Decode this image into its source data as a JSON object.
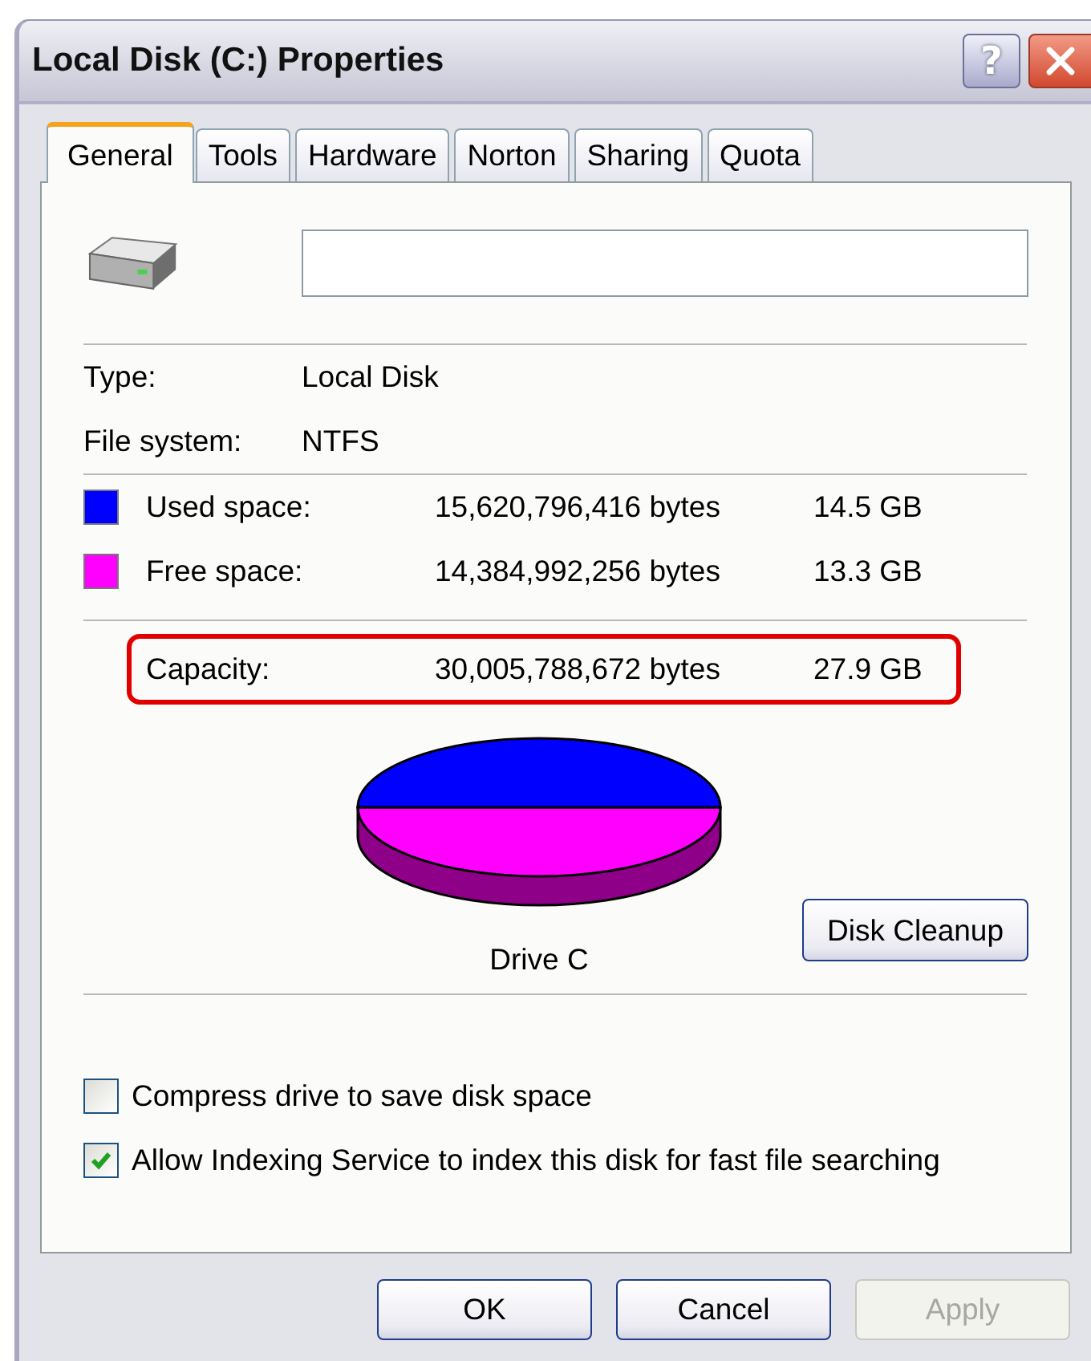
{
  "window": {
    "title": "Local Disk (C:) Properties",
    "help": "?"
  },
  "tabs": [
    {
      "label": "General",
      "selected": true
    },
    {
      "label": "Tools",
      "selected": false
    },
    {
      "label": "Hardware",
      "selected": false
    },
    {
      "label": "Norton",
      "selected": false
    },
    {
      "label": "Sharing",
      "selected": false
    },
    {
      "label": "Quota",
      "selected": false
    }
  ],
  "info": [
    {
      "label": "Type:",
      "value": "Local Disk"
    },
    {
      "label": "File system:",
      "value": "NTFS"
    }
  ],
  "space": [
    {
      "label": "Used space:",
      "bytes": "15,620,796,416 bytes",
      "size": "14.5 GB",
      "color": "#0000ff"
    },
    {
      "label": "Free space:",
      "bytes": "14,384,992,256 bytes",
      "size": "13.3 GB",
      "color": "#ff00ff"
    }
  ],
  "capacity": {
    "label": "Capacity:",
    "bytes": "30,005,788,672 bytes",
    "size": "27.9 GB",
    "highlighted": true
  },
  "drive_label": "Drive C",
  "cleanup_button": "Disk Cleanup",
  "options": [
    {
      "label": "Compress drive to save disk space",
      "checked": false
    },
    {
      "label": "Allow Indexing Service to index this disk for fast file searching",
      "checked": true
    }
  ],
  "buttons": [
    {
      "label": "OK",
      "disabled": false
    },
    {
      "label": "Cancel",
      "disabled": false
    },
    {
      "label": "Apply",
      "disabled": true
    }
  ]
}
